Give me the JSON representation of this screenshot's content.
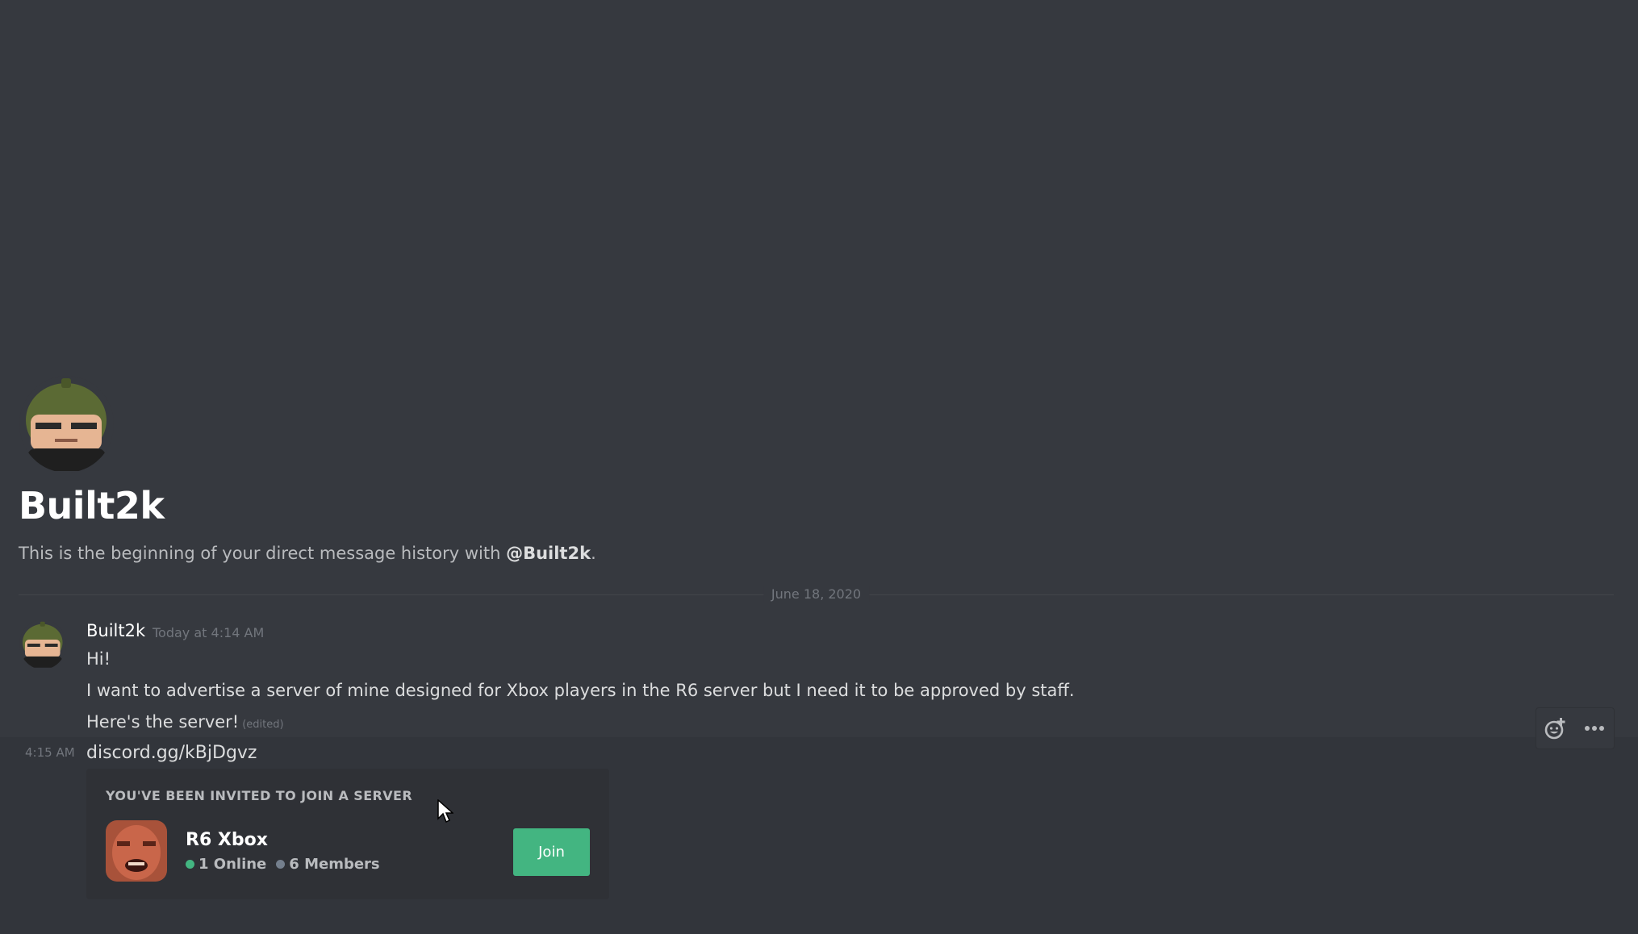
{
  "channel": {
    "name": "Built2k",
    "intro_text": "This is the beginning of your direct message history with ",
    "intro_mention": "@Built2k",
    "intro_end": "."
  },
  "date_divider": "June 18, 2020",
  "message": {
    "author": "Built2k",
    "timestamp": "Today at 4:14 AM",
    "lines": [
      "Hi!",
      "I want to advertise a server of mine designed for Xbox players in the R6 server but I need it to be approved by staff.",
      "Here's the server!"
    ],
    "edited_label": "(edited)",
    "followup_time": "4:15 AM",
    "link_text": "discord.gg/kBjDgvz"
  },
  "invite": {
    "heading": "YOU'VE BEEN INVITED TO JOIN A SERVER",
    "server_name": "R6 Xbox",
    "online": "1 Online",
    "members": "6 Members",
    "join_label": "Join"
  },
  "toolbar": {
    "icons": [
      "add-reaction-icon",
      "more-options-icon"
    ]
  },
  "colors": {
    "background": "#36393f",
    "accent_green": "#43b581",
    "muted_text": "#72767d"
  }
}
